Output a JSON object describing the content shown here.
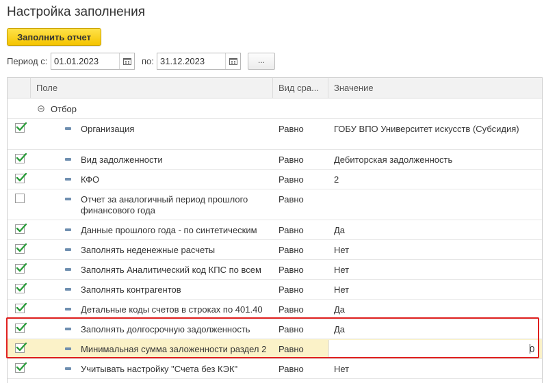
{
  "page": {
    "title": "Настройка заполнения"
  },
  "toolbar": {
    "fill_button": "Заполнить отчет"
  },
  "period": {
    "from_label": "Период с:",
    "from_value": "01.01.2023",
    "to_label": "по:",
    "to_value": "31.12.2023",
    "dots_label": "..."
  },
  "grid": {
    "columns": {
      "field": "Поле",
      "compare": "Вид сра...",
      "value": "Значение"
    },
    "group": {
      "label": "Отбор"
    },
    "rows": [
      {
        "checked": true,
        "field": "Организация",
        "field2": "",
        "compare": "Равно",
        "value": "ГОБУ ВПО Университет искусств (Субсидия)"
      },
      {
        "checked": true,
        "field": "Вид задолженности",
        "field2": "",
        "compare": "Равно",
        "value": "Дебиторская задолженность"
      },
      {
        "checked": true,
        "field": "КФО",
        "field2": "",
        "compare": "Равно",
        "value": "2"
      },
      {
        "checked": false,
        "field": "Отчет за аналогичный период прошлого",
        "field2": "финансового года",
        "compare": "Равно",
        "value": ""
      },
      {
        "checked": true,
        "field": "Данные прошлого года - по синтетическим",
        "field2": "",
        "compare": "Равно",
        "value": "Да"
      },
      {
        "checked": true,
        "field": "Заполнять неденежные расчеты",
        "field2": "",
        "compare": "Равно",
        "value": "Нет"
      },
      {
        "checked": true,
        "field": "Заполнять Аналитический код КПС по всем",
        "field2": "",
        "compare": "Равно",
        "value": "Нет"
      },
      {
        "checked": true,
        "field": "Заполнять контрагентов",
        "field2": "",
        "compare": "Равно",
        "value": "Нет"
      },
      {
        "checked": true,
        "field": "Детальные коды счетов в строках по 401.40",
        "field2": "",
        "compare": "Равно",
        "value": "Да"
      },
      {
        "checked": true,
        "field": "Заполнять долгосрочную задолженность",
        "field2": "",
        "compare": "Равно",
        "value": "Да"
      },
      {
        "checked": true,
        "field": "Минимальная сумма заложенности раздел 2",
        "field2": "",
        "compare": "Равно",
        "value": "0",
        "selected": true
      },
      {
        "checked": true,
        "field": "Учитывать настройку \"Счета без КЭК\"",
        "field2": "",
        "compare": "Равно",
        "value": "Нет"
      }
    ]
  },
  "colors": {
    "accent": "#f5c400",
    "highlight_border": "#e0201f",
    "checkmark": "#2a9d3a",
    "selected_row": "#fbf2c8"
  }
}
